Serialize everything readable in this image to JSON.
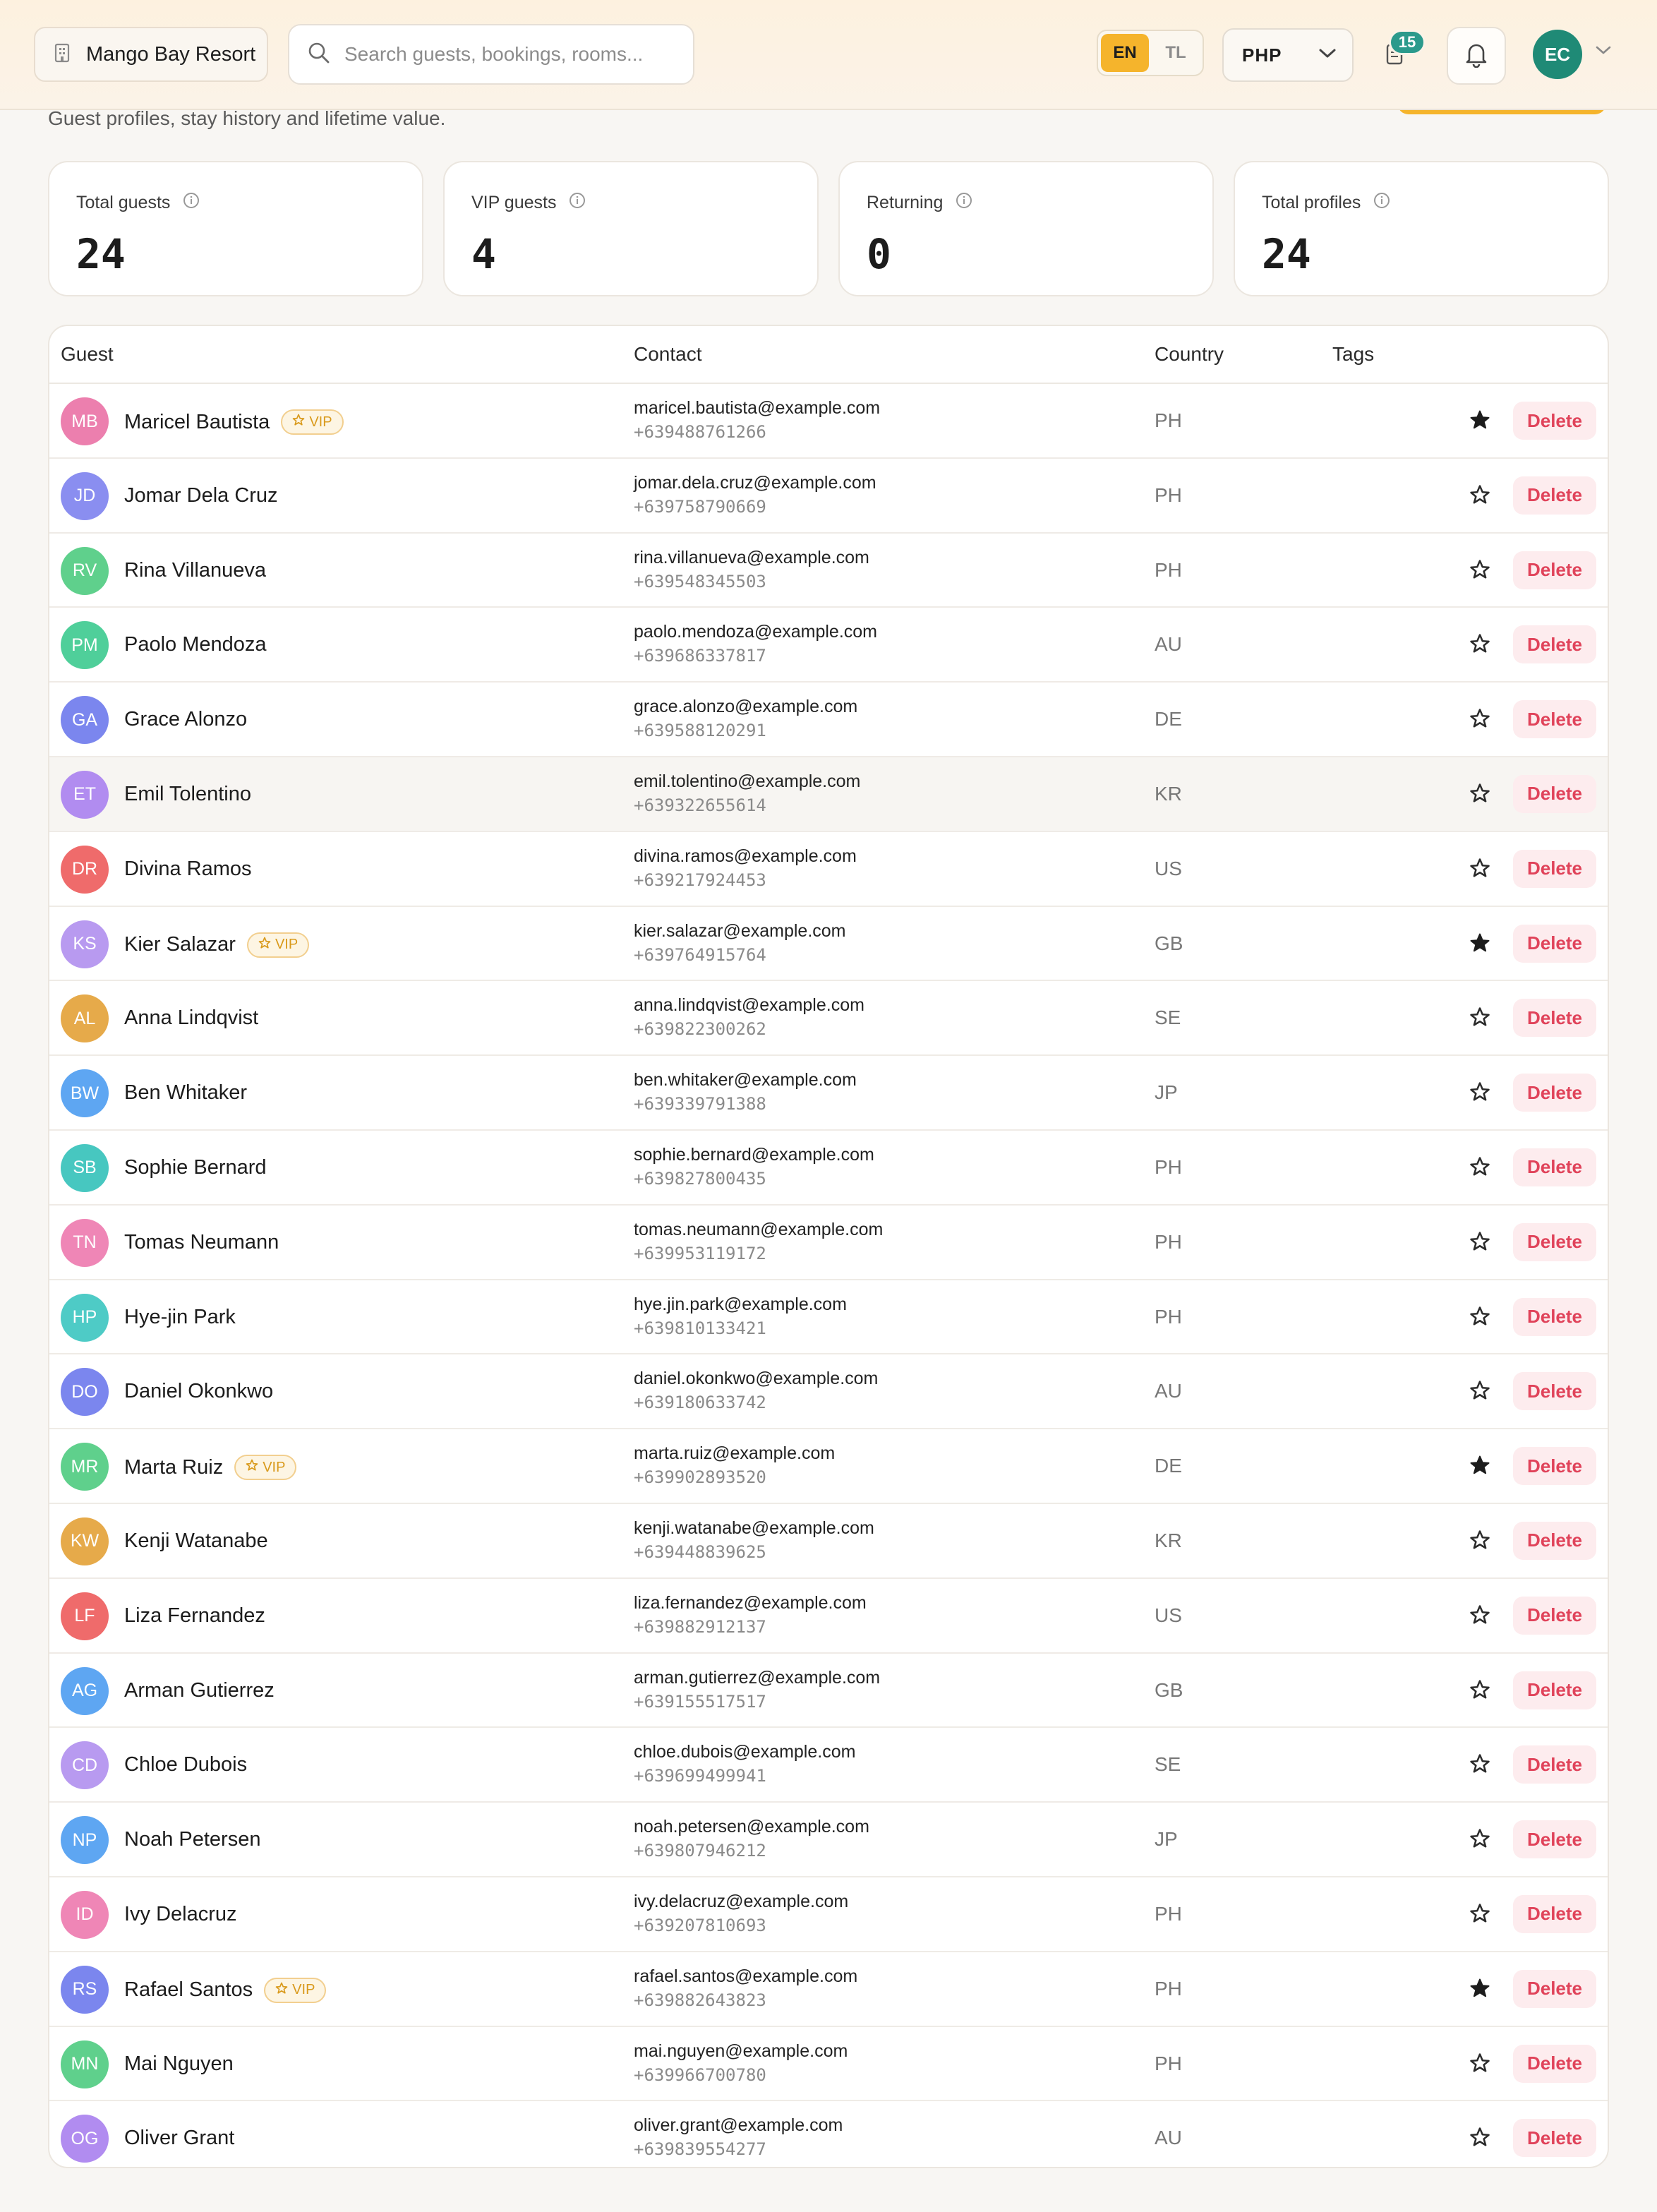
{
  "header": {
    "property": "Mango Bay Resort",
    "search_placeholder": "Search guests, bookings, rooms...",
    "languages": [
      "EN",
      "TL"
    ],
    "active_language": "EN",
    "currency": "PHP",
    "notification_count": "15",
    "user_initials": "EC"
  },
  "page": {
    "subtitle": "Guest profiles, stay history and lifetime value."
  },
  "stats": [
    {
      "label": "Total guests",
      "value": "24"
    },
    {
      "label": "VIP guests",
      "value": "4"
    },
    {
      "label": "Returning",
      "value": "0"
    },
    {
      "label": "Total profiles",
      "value": "24"
    }
  ],
  "table": {
    "columns": [
      "Guest",
      "Contact",
      "Country",
      "Tags"
    ],
    "delete_label": "Delete",
    "vip_label": "VIP",
    "rows": [
      {
        "initials": "MB",
        "name": "Maricel Bautista",
        "vip": true,
        "email": "maricel.bautista@example.com",
        "phone": "+639488761266",
        "country": "PH",
        "starred": true,
        "color": "#ec7fae"
      },
      {
        "initials": "JD",
        "name": "Jomar Dela Cruz",
        "vip": false,
        "email": "jomar.dela.cruz@example.com",
        "phone": "+639758790669",
        "country": "PH",
        "starred": false,
        "color": "#8a8ef0"
      },
      {
        "initials": "RV",
        "name": "Rina Villanueva",
        "vip": false,
        "email": "rina.villanueva@example.com",
        "phone": "+639548345503",
        "country": "PH",
        "starred": false,
        "color": "#5fd08c"
      },
      {
        "initials": "PM",
        "name": "Paolo Mendoza",
        "vip": false,
        "email": "paolo.mendoza@example.com",
        "phone": "+639686337817",
        "country": "AU",
        "starred": false,
        "color": "#4fcf9a"
      },
      {
        "initials": "GA",
        "name": "Grace Alonzo",
        "vip": false,
        "email": "grace.alonzo@example.com",
        "phone": "+639588120291",
        "country": "DE",
        "starred": false,
        "color": "#7b86ee"
      },
      {
        "initials": "ET",
        "name": "Emil Tolentino",
        "vip": false,
        "email": "emil.tolentino@example.com",
        "phone": "+639322655614",
        "country": "KR",
        "starred": false,
        "color": "#b18cf0"
      },
      {
        "initials": "DR",
        "name": "Divina Ramos",
        "vip": false,
        "email": "divina.ramos@example.com",
        "phone": "+639217924453",
        "country": "US",
        "starred": false,
        "color": "#ef6b6b"
      },
      {
        "initials": "KS",
        "name": "Kier Salazar",
        "vip": true,
        "email": "kier.salazar@example.com",
        "phone": "+639764915764",
        "country": "GB",
        "starred": true,
        "color": "#b89af0"
      },
      {
        "initials": "AL",
        "name": "Anna Lindqvist",
        "vip": false,
        "email": "anna.lindqvist@example.com",
        "phone": "+639822300262",
        "country": "SE",
        "starred": false,
        "color": "#e6aa4a"
      },
      {
        "initials": "BW",
        "name": "Ben Whitaker",
        "vip": false,
        "email": "ben.whitaker@example.com",
        "phone": "+639339791388",
        "country": "JP",
        "starred": false,
        "color": "#5ea6f2"
      },
      {
        "initials": "SB",
        "name": "Sophie Bernard",
        "vip": false,
        "email": "sophie.bernard@example.com",
        "phone": "+639827800435",
        "country": "PH",
        "starred": false,
        "color": "#47c7c0"
      },
      {
        "initials": "TN",
        "name": "Tomas Neumann",
        "vip": false,
        "email": "tomas.neumann@example.com",
        "phone": "+639953119172",
        "country": "PH",
        "starred": false,
        "color": "#ef86b6"
      },
      {
        "initials": "HP",
        "name": "Hye-jin Park",
        "vip": false,
        "email": "hye.jin.park@example.com",
        "phone": "+639810133421",
        "country": "PH",
        "starred": false,
        "color": "#4ecbc6"
      },
      {
        "initials": "DO",
        "name": "Daniel Okonkwo",
        "vip": false,
        "email": "daniel.okonkwo@example.com",
        "phone": "+639180633742",
        "country": "AU",
        "starred": false,
        "color": "#7b86ee"
      },
      {
        "initials": "MR",
        "name": "Marta Ruiz",
        "vip": true,
        "email": "marta.ruiz@example.com",
        "phone": "+639902893520",
        "country": "DE",
        "starred": true,
        "color": "#5fd08c"
      },
      {
        "initials": "KW",
        "name": "Kenji Watanabe",
        "vip": false,
        "email": "kenji.watanabe@example.com",
        "phone": "+639448839625",
        "country": "KR",
        "starred": false,
        "color": "#e6aa4a"
      },
      {
        "initials": "LF",
        "name": "Liza Fernandez",
        "vip": false,
        "email": "liza.fernandez@example.com",
        "phone": "+639882912137",
        "country": "US",
        "starred": false,
        "color": "#ef6b6b"
      },
      {
        "initials": "AG",
        "name": "Arman Gutierrez",
        "vip": false,
        "email": "arman.gutierrez@example.com",
        "phone": "+639155517517",
        "country": "GB",
        "starred": false,
        "color": "#5ea6f2"
      },
      {
        "initials": "CD",
        "name": "Chloe Dubois",
        "vip": false,
        "email": "chloe.dubois@example.com",
        "phone": "+639699499941",
        "country": "SE",
        "starred": false,
        "color": "#b89af0"
      },
      {
        "initials": "NP",
        "name": "Noah Petersen",
        "vip": false,
        "email": "noah.petersen@example.com",
        "phone": "+639807946212",
        "country": "JP",
        "starred": false,
        "color": "#5ea6f2"
      },
      {
        "initials": "ID",
        "name": "Ivy Delacruz",
        "vip": false,
        "email": "ivy.delacruz@example.com",
        "phone": "+639207810693",
        "country": "PH",
        "starred": false,
        "color": "#ef86b6"
      },
      {
        "initials": "RS",
        "name": "Rafael Santos",
        "vip": true,
        "email": "rafael.santos@example.com",
        "phone": "+639882643823",
        "country": "PH",
        "starred": true,
        "color": "#7b86ee"
      },
      {
        "initials": "MN",
        "name": "Mai Nguyen",
        "vip": false,
        "email": "mai.nguyen@example.com",
        "phone": "+639966700780",
        "country": "PH",
        "starred": false,
        "color": "#5fd08c"
      },
      {
        "initials": "OG",
        "name": "Oliver Grant",
        "vip": false,
        "email": "oliver.grant@example.com",
        "phone": "+639839554277",
        "country": "AU",
        "starred": false,
        "color": "#b18cf0"
      }
    ],
    "highlighted_row": 5
  },
  "colors": {
    "accent": "#f5b42c",
    "teal": "#2b9a8c",
    "delete_text": "#e0435a",
    "delete_bg": "#fdecee"
  },
  "icons": [
    "building-icon",
    "search-icon",
    "chevron-down-icon",
    "clipboard-icon",
    "bell-icon",
    "info-icon",
    "star-icon"
  ]
}
